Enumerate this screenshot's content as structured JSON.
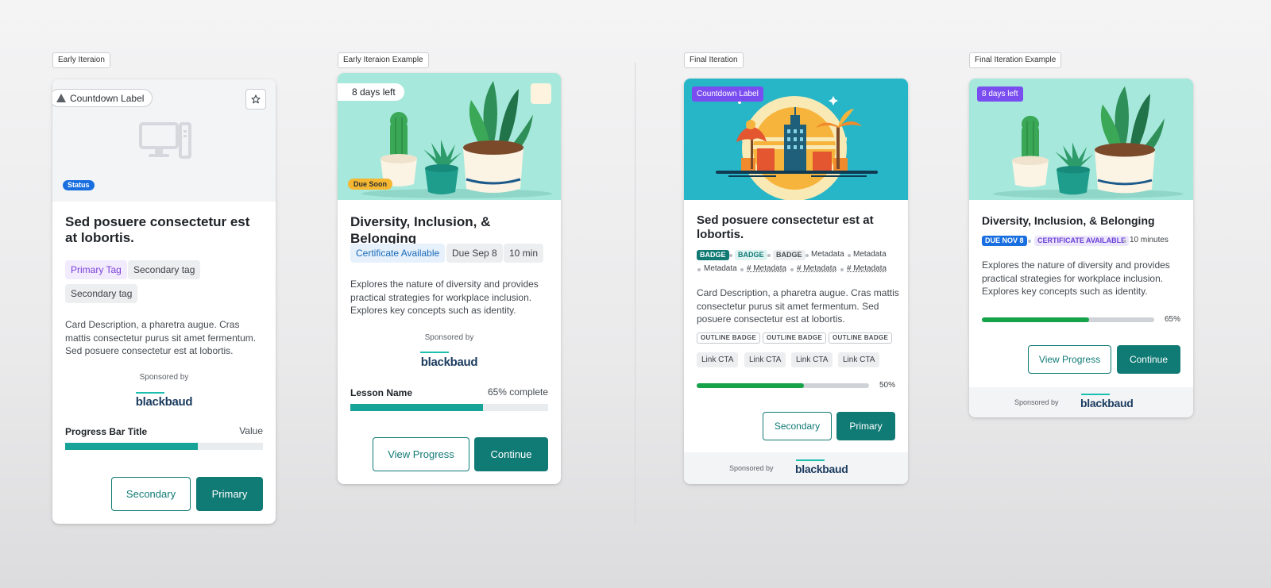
{
  "labels": {
    "early_iteration": "Early Iteraion",
    "early_iteration_example": "Early Iteraion Example",
    "final_iteration": "Final Iteration",
    "final_iteration_example": "Final Iteration Example"
  },
  "card1": {
    "countdown_label": "Countdown Label",
    "status": "Status",
    "title": "Sed posuere consectetur est at lobortis.",
    "tags": [
      "Primary Tag",
      "Secondary tag",
      "Secondary tag"
    ],
    "description": "Card Description, a pharetra augue. Cras mattis consectetur purus sit amet fermentum. Sed posuere consectetur est at lobortis.",
    "sponsored_by": "Sponsored by",
    "logo": "blackbaud",
    "progress_title": "Progress Bar Title",
    "progress_value_label": "Value",
    "progress_fraction": 0.67,
    "secondary_button": "Secondary",
    "primary_button": "Primary",
    "icons": [
      "warning-triangle-icon",
      "star-icon",
      "computer-placeholder-icon"
    ]
  },
  "card2": {
    "days_left": "8 days left",
    "due_soon": "Due Soon",
    "title": "Diversity, Inclusion, & Belonging",
    "tags": [
      "Certificate Available",
      "Due Sep 8",
      "10 min"
    ],
    "description": "Explores the nature of diversity and provides practical strategies for workplace inclusion. Explores key concepts such as identity.",
    "sponsored_by": "Sponsored by",
    "logo": "blackbaud",
    "lesson_name": "Lesson Name",
    "progress_label": "65% complete",
    "progress_fraction": 0.67,
    "view_progress_button": "View Progress",
    "continue_button": "Continue"
  },
  "card3": {
    "countdown_label": "Countdown Label",
    "title": "Sed posuere consectetur est at lobortis.",
    "badges": [
      "BADGE",
      "BADGE",
      "BADGE"
    ],
    "metadata": [
      "Metadata",
      "Metadata",
      "Metadata",
      "# Metadata",
      "# Metadata",
      "# Metadata"
    ],
    "description": "Card Description, a pharetra augue. Cras mattis consectetur purus sit amet fermentum. Sed posuere consectetur est at lobortis.",
    "outline_badges": [
      "OUTLINE BADGE",
      "OUTLINE BADGE",
      "OUTLINE BADGE"
    ],
    "link_ctas": [
      "Link CTA",
      "Link CTA",
      "Link CTA",
      "Link CTA"
    ],
    "progress_label": "50%",
    "progress_fraction": 0.62,
    "secondary_button": "Secondary",
    "primary_button": "Primary",
    "sponsored_by": "Sponsored by",
    "logo": "blackbaud"
  },
  "card4": {
    "days_left": "8 days left",
    "title": "Diversity, Inclusion, & Belonging",
    "badge_due": "DUE NOV 8",
    "badge_certificate": "CERTIFICATE AVAILABLE",
    "duration": "10 minutes",
    "description": "Explores the nature of diversity and provides practical strategies for workplace inclusion. Explores key concepts such as identity.",
    "progress_label": "65%",
    "progress_fraction": 0.62,
    "view_progress_button": "View Progress",
    "continue_button": "Continue",
    "sponsored_by": "Sponsored by",
    "logo": "blackbaud"
  },
  "colors": {
    "brand_teal": "#107a75",
    "progress_teal": "#17a398",
    "progress_green": "#16a34a",
    "status_blue": "#1a6fe0",
    "countdown_purple": "#7a4df0",
    "due_soon_yellow": "#f5b731",
    "plant_bg": "#a6e8db",
    "city_bg": "#27b6c7"
  }
}
